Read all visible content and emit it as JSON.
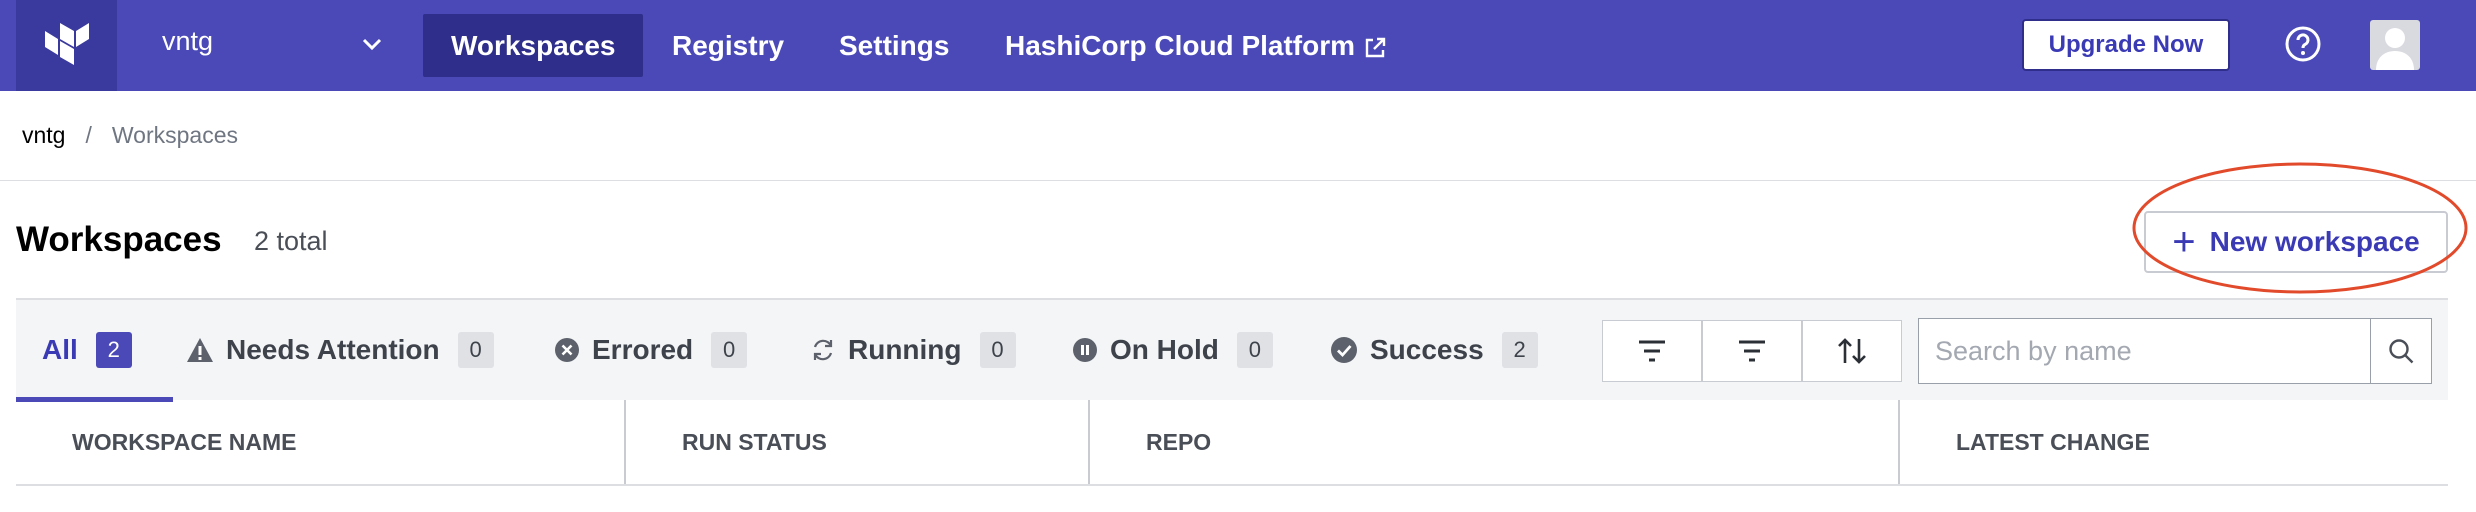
{
  "topbar": {
    "org_name": "vntg",
    "nav": [
      {
        "label": "Workspaces",
        "active": true
      },
      {
        "label": "Registry",
        "active": false
      },
      {
        "label": "Settings",
        "active": false
      },
      {
        "label": "HashiCorp Cloud Platform",
        "active": false,
        "external": true
      }
    ],
    "upgrade_label": "Upgrade Now",
    "colors": {
      "bar": "#4a49b7",
      "active": "#2f2e8b"
    }
  },
  "breadcrumb": {
    "org": "vntg",
    "separator": "/",
    "page": "Workspaces"
  },
  "header": {
    "title": "Workspaces",
    "count": "2 total",
    "new_button_label": "New workspace"
  },
  "filters": {
    "tabs": [
      {
        "label": "All",
        "count": "2",
        "icon": "none",
        "active": true
      },
      {
        "label": "Needs Attention",
        "count": "0",
        "icon": "warning-icon"
      },
      {
        "label": "Errored",
        "count": "0",
        "icon": "error-circle-icon"
      },
      {
        "label": "Running",
        "count": "0",
        "icon": "refresh-icon"
      },
      {
        "label": "On Hold",
        "count": "0",
        "icon": "pause-circle-icon"
      },
      {
        "label": "Success",
        "count": "2",
        "icon": "check-circle-icon"
      }
    ],
    "tools": [
      "filter-icon",
      "filter-icon",
      "sort-icon"
    ],
    "search_placeholder": "Search by name"
  },
  "table": {
    "columns": [
      "WORKSPACE NAME",
      "RUN STATUS",
      "REPO",
      "LATEST CHANGE"
    ]
  }
}
